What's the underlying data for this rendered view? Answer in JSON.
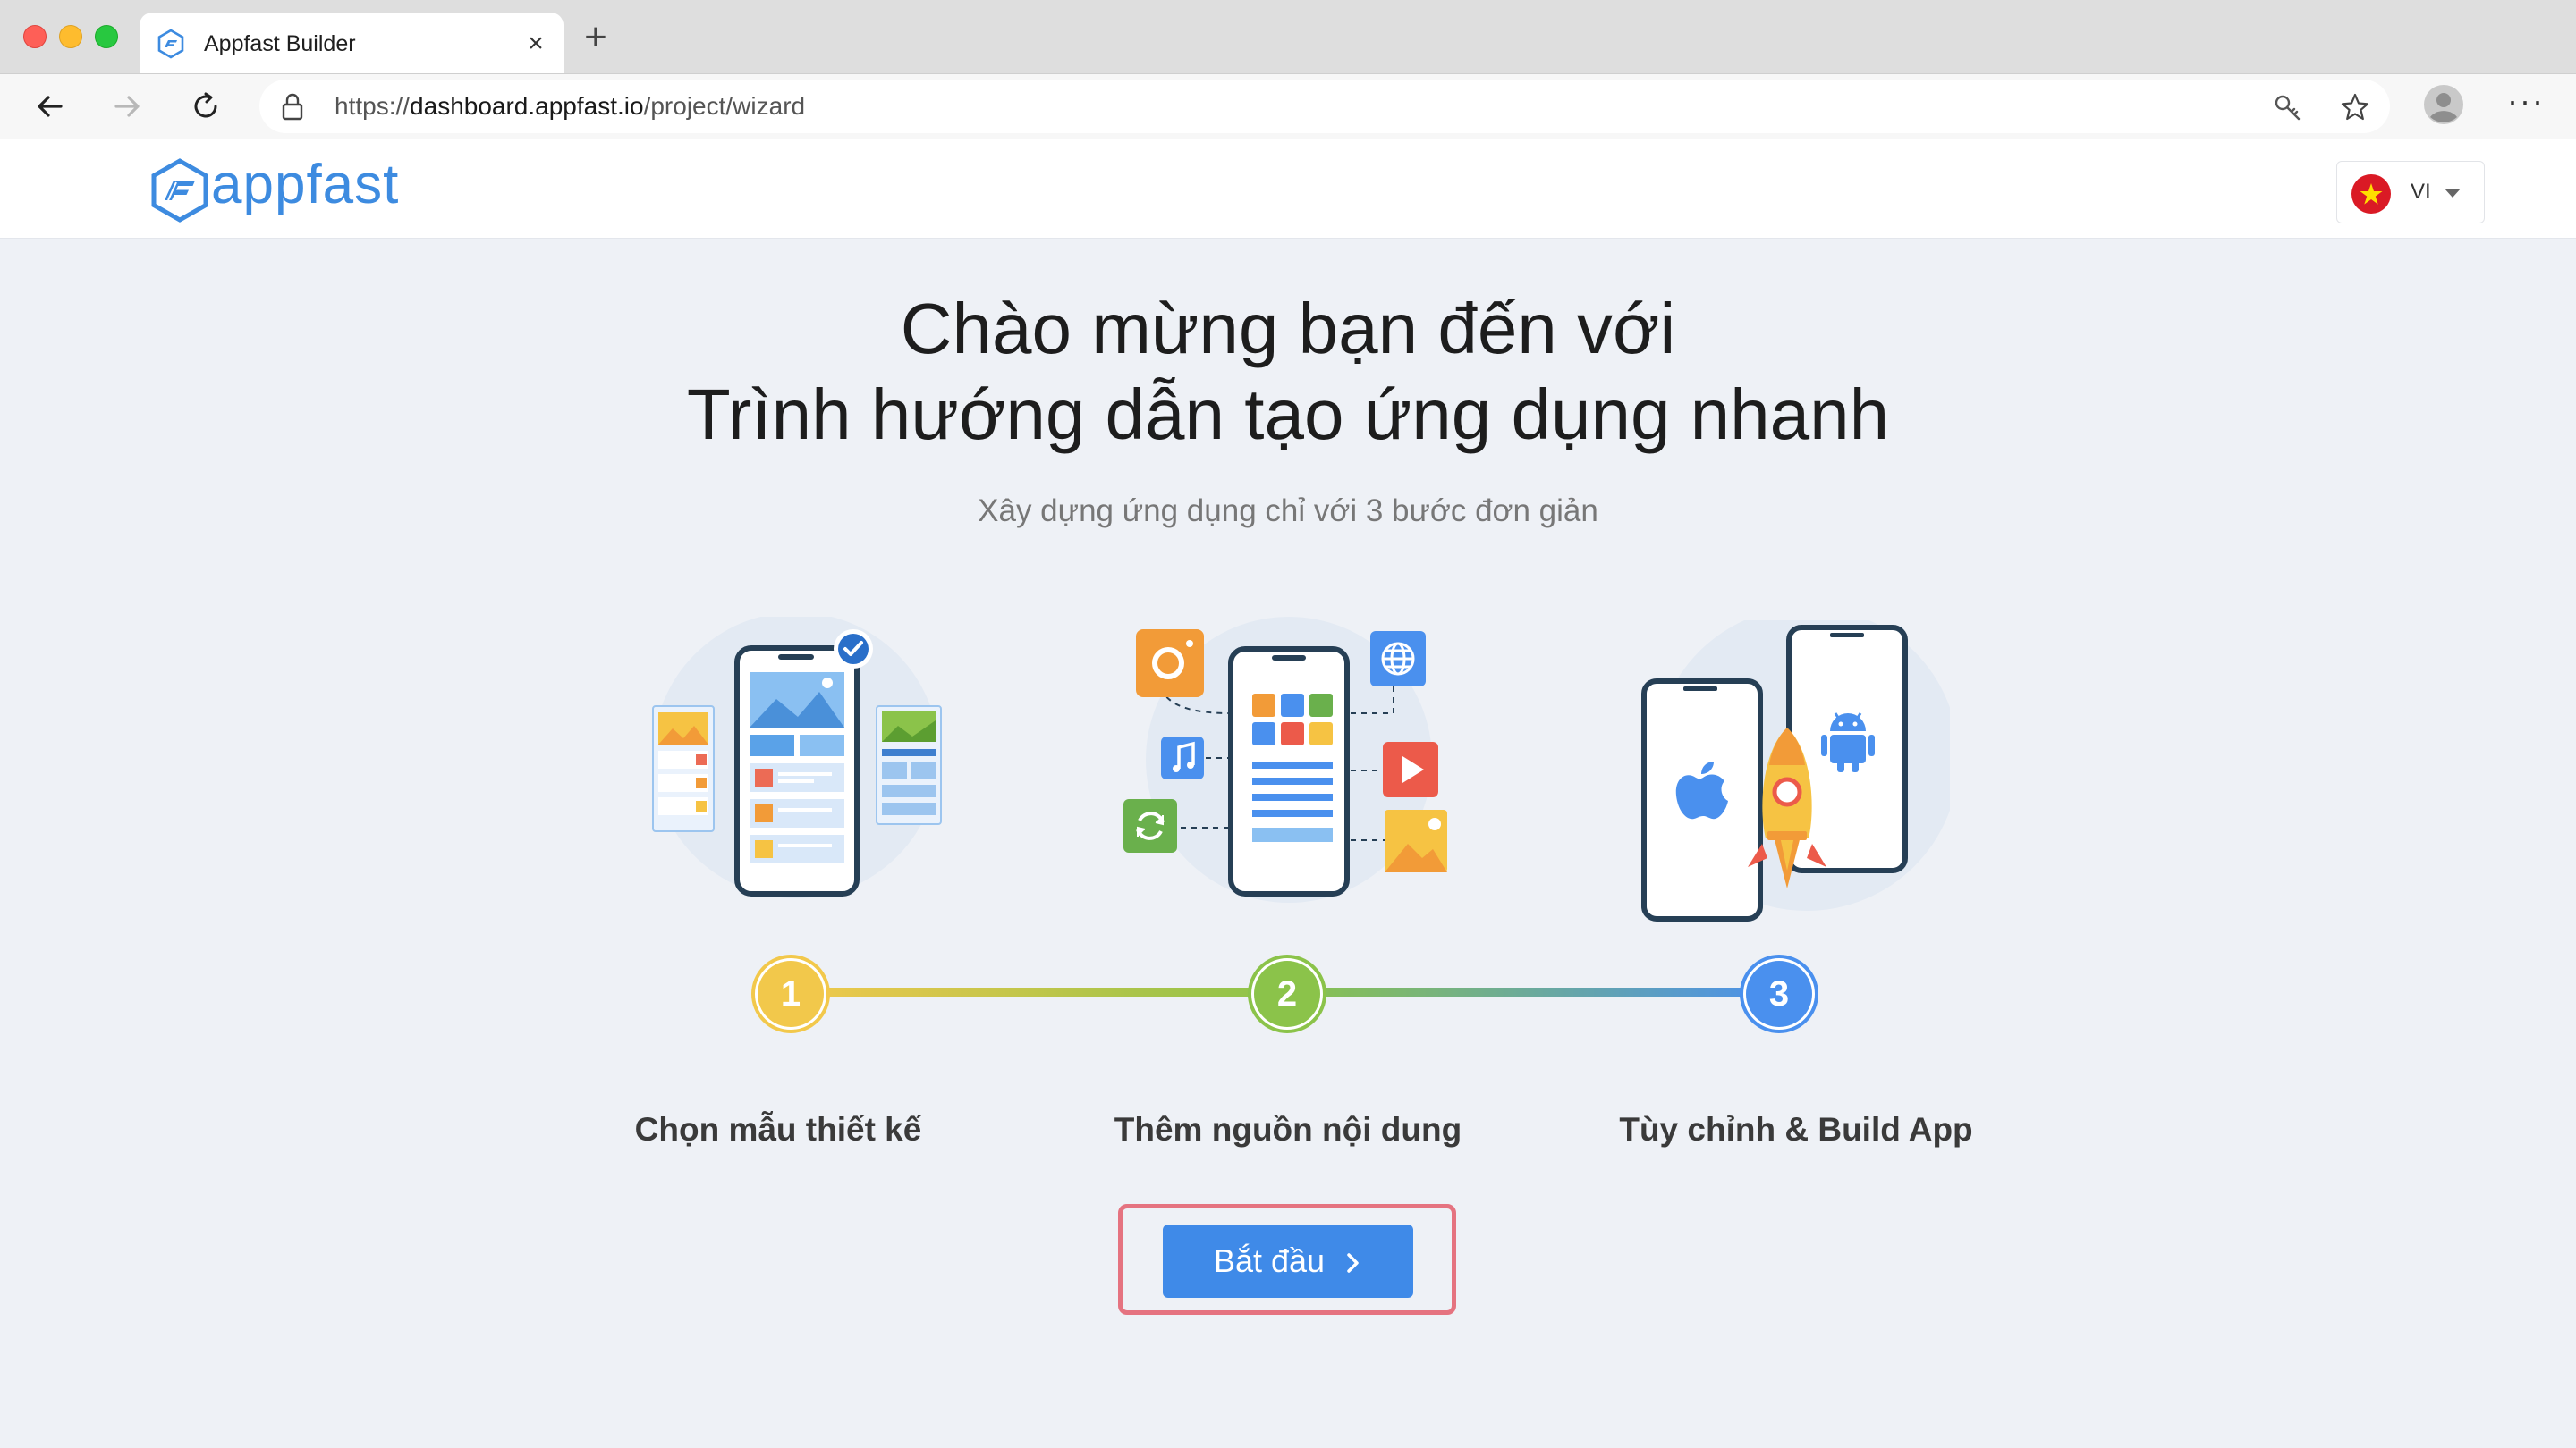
{
  "browser": {
    "tab_title": "Appfast Builder",
    "url_scheme": "https://",
    "url_host": "dashboard.appfast.io",
    "url_path": "/project/wizard"
  },
  "header": {
    "logo_text": "appfast",
    "language_code": "VI"
  },
  "hero": {
    "title_line1": "Chào mừng bạn đến với",
    "title_line2": "Trình hướng dẫn tạo ứng dụng nhanh",
    "subtitle": "Xây dựng ứng dụng chỉ với 3 bước đơn giản"
  },
  "steps": [
    {
      "number": "1",
      "label": "Chọn mẫu thiết kế",
      "color": "#f2c84b"
    },
    {
      "number": "2",
      "label": "Thêm nguồn nội dung",
      "color": "#8bc34a"
    },
    {
      "number": "3",
      "label": "Tùy chỉnh & Build App",
      "color": "#4a90ee"
    }
  ],
  "cta": {
    "label": "Bắt đầu",
    "icon": "chevron-right-icon"
  },
  "colors": {
    "accent": "#3f8ae8",
    "page_bg": "#eef1f6",
    "highlight_outline": "#e57380"
  }
}
